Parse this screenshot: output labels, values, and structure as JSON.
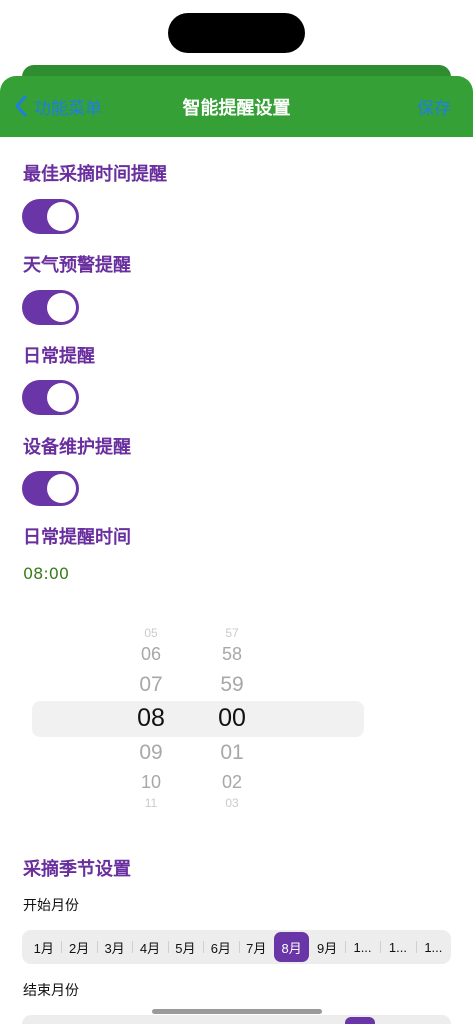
{
  "nav": {
    "back_label": "功能菜单",
    "title": "智能提醒设置",
    "save_label": "保存"
  },
  "reminders": [
    {
      "label": "最佳采摘时间提醒",
      "enabled": true
    },
    {
      "label": "天气预警提醒",
      "enabled": true
    },
    {
      "label": "日常提醒",
      "enabled": true
    },
    {
      "label": "设备维护提醒",
      "enabled": true
    }
  ],
  "daily_time": {
    "label": "日常提醒时间",
    "value": "08:00"
  },
  "picker": {
    "hours": [
      "05",
      "06",
      "07",
      "08",
      "09",
      "10",
      "11"
    ],
    "minutes": [
      "57",
      "58",
      "59",
      "00",
      "01",
      "02",
      "03"
    ],
    "selected_hour": "08",
    "selected_minute": "00"
  },
  "season": {
    "title": "采摘季节设置",
    "start_label": "开始月份",
    "end_label": "结束月份",
    "months": [
      "1月",
      "2月",
      "3月",
      "4月",
      "5月",
      "6月",
      "7月",
      "8月",
      "9月",
      "1...",
      "1...",
      "1..."
    ],
    "start_selected": "8月"
  },
  "colors": {
    "nav_green": "#34a035",
    "accent_purple": "#6a35a6",
    "link_blue": "#1f7ee0",
    "time_green": "#3b7d1c"
  }
}
